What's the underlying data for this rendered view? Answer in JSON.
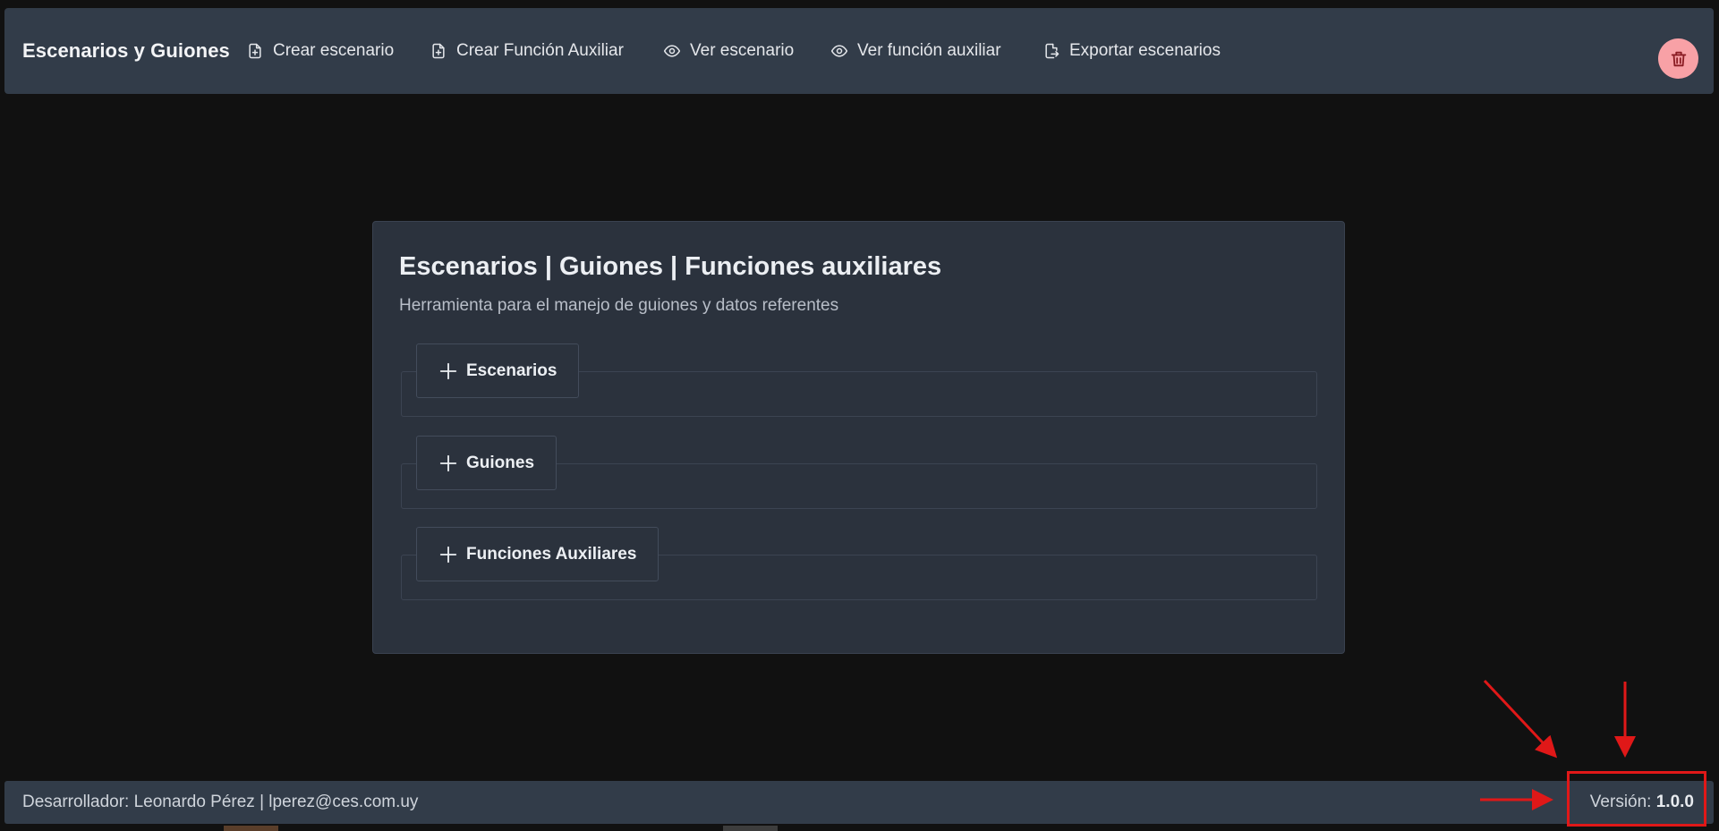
{
  "navbar": {
    "brand": "Escenarios y Guiones",
    "items": [
      {
        "label": "Crear escenario",
        "icon": "file-plus-icon"
      },
      {
        "label": "Crear Función Auxiliar",
        "icon": "file-plus-icon"
      },
      {
        "label": "Ver escenario",
        "icon": "eye-icon"
      },
      {
        "label": "Ver función auxiliar",
        "icon": "eye-icon"
      },
      {
        "label": "Exportar escenarios",
        "icon": "file-export-icon"
      }
    ],
    "delete_icon": "trash-icon"
  },
  "card": {
    "title": "Escenarios | Guiones | Funciones auxiliares",
    "subtitle": "Herramienta para el manejo de guiones y datos referentes",
    "sections": [
      {
        "label": "Escenarios",
        "icon": "plus-icon"
      },
      {
        "label": "Guiones",
        "icon": "plus-icon"
      },
      {
        "label": "Funciones Auxiliares",
        "icon": "plus-icon"
      }
    ]
  },
  "footer": {
    "developer": "Desarrollador: Leonardo Pérez | lperez@ces.com.uy",
    "version_label": "Versión: ",
    "version_value": "1.0.0"
  },
  "colors": {
    "background": "#111111",
    "panel": "#323c49",
    "card": "#2b323d",
    "delete_button": "#f8a1a6",
    "annotation": "#e01818"
  }
}
